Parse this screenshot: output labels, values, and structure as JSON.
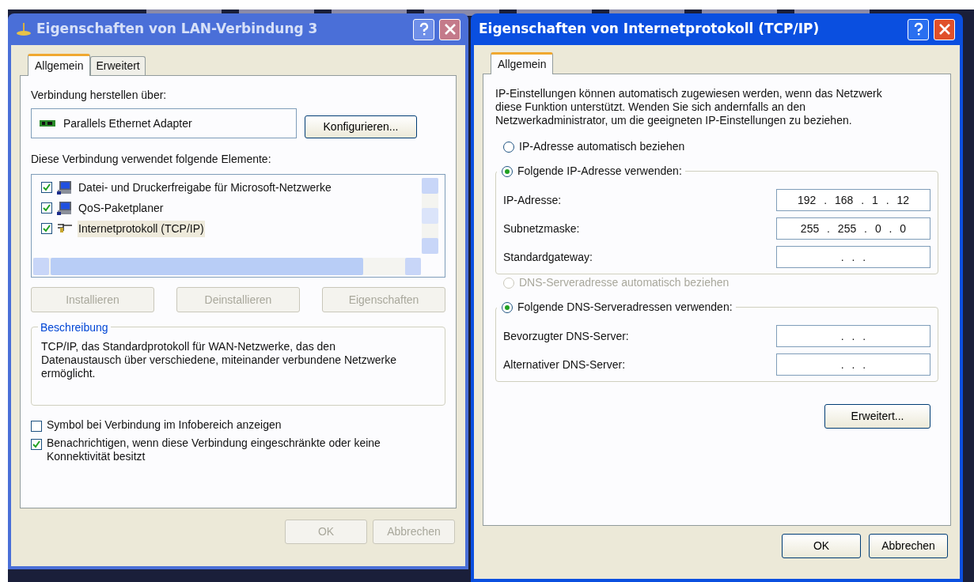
{
  "left_dialog": {
    "title": "Eigenschaften von LAN-Verbindung 3",
    "tabs": [
      {
        "label": "Allgemein",
        "selected": true
      },
      {
        "label": "Erweitert",
        "selected": false
      }
    ],
    "connect_label": "Verbindung herstellen über:",
    "adapter": "Parallels Ethernet Adapter",
    "configure_button": "Konfigurieren...",
    "elements_label": "Diese Verbindung verwendet folgende Elemente:",
    "elements": [
      {
        "label": "Datei- und Druckerfreigabe für Microsoft-Netzwerke",
        "checked": true,
        "selected": false,
        "kind": "computer"
      },
      {
        "label": "QoS-Paketplaner",
        "checked": true,
        "selected": false,
        "kind": "computer"
      },
      {
        "label": "Internetprotokoll (TCP/IP)",
        "checked": true,
        "selected": true,
        "kind": "protocol"
      }
    ],
    "element_buttons": [
      {
        "label": "Installieren",
        "disabled": true
      },
      {
        "label": "Deinstallieren",
        "disabled": true
      },
      {
        "label": "Eigenschaften",
        "disabled": true
      }
    ],
    "description": {
      "title": "Beschreibung",
      "text": "TCP/IP, das Standardprotokoll für WAN-Netzwerke, das den Datenaustausch über verschiedene, miteinander verbundene Netzwerke ermöglicht."
    },
    "options": [
      {
        "label": "Symbol bei Verbindung im Infobereich anzeigen",
        "checked": false
      },
      {
        "label": "Benachrichtigen, wenn diese Verbindung eingeschränkte oder keine Konnektivität besitzt",
        "checked": true
      }
    ],
    "footer_buttons": [
      {
        "label": "OK",
        "disabled": true
      },
      {
        "label": "Abbrechen",
        "disabled": true
      }
    ]
  },
  "right_dialog": {
    "title": "Eigenschaften von Internetprotokoll (TCP/IP)",
    "tabs": [
      {
        "label": "Allgemein",
        "selected": true
      }
    ],
    "intro": "IP-Einstellungen können automatisch zugewiesen werden, wenn das Netzwerk diese Funktion unterstützt. Wenden Sie sich andernfalls an den Netzwerkadministrator, um die geeigneten IP-Einstellungen zu beziehen.",
    "ip_group": {
      "radios": [
        {
          "label": "IP-Adresse automatisch beziehen",
          "selected": false,
          "disabled": false
        },
        {
          "label": "Folgende IP-Adresse verwenden:",
          "selected": true,
          "disabled": false
        }
      ],
      "fields": [
        {
          "label": "IP-Adresse:",
          "value": "192 . 168 . 1 . 12"
        },
        {
          "label": "Subnetzmaske:",
          "value": "255 . 255 . 0 . 0"
        },
        {
          "label": "Standardgateway:",
          "value": ". . ."
        }
      ]
    },
    "dns_group": {
      "radios": [
        {
          "label": "DNS-Serveradresse automatisch beziehen",
          "selected": false,
          "disabled": true
        },
        {
          "label": "Folgende DNS-Serveradressen verwenden:",
          "selected": true,
          "disabled": false
        }
      ],
      "fields": [
        {
          "label": "Bevorzugter DNS-Server:",
          "value": ". . ."
        },
        {
          "label": "Alternativer DNS-Server:",
          "value": ". . ."
        }
      ]
    },
    "advanced_button": "Erweitert...",
    "footer_buttons": [
      {
        "label": "OK",
        "disabled": false
      },
      {
        "label": "Abbrechen",
        "disabled": false
      }
    ]
  }
}
